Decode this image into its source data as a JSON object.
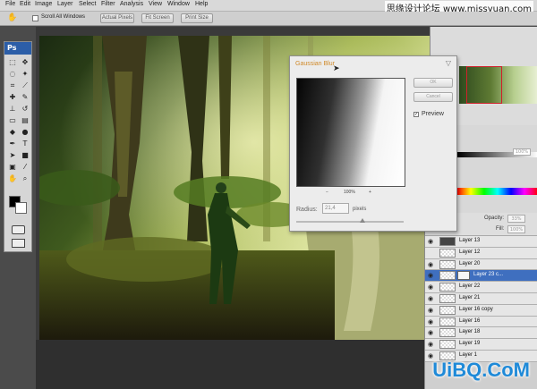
{
  "menu": [
    "File",
    "Edit",
    "Image",
    "Layer",
    "Select",
    "Filter",
    "Analysis",
    "View",
    "Window",
    "Help"
  ],
  "watermark_top": "思缘设计论坛 www.missyuan.com",
  "options_bar": {
    "scroll_all_label": "Scroll All Windows",
    "actual_pixels": "Actual Pixels",
    "fit_screen": "Fit Screen",
    "print_size": "Print Size"
  },
  "tools_header": "Ps",
  "dialog": {
    "title": "Gaussian Blur",
    "close_glyph": "▽",
    "ok_label": "OK",
    "cancel_label": "Cancel",
    "preview_label": "Preview",
    "zoom_minus": "−",
    "zoom_value": "100%",
    "zoom_plus": "+",
    "radius_label": "Radius:",
    "radius_value": "21,4",
    "radius_unit": "pixels",
    "slider_fraction": 0.62
  },
  "color_panel": {
    "percent": "100%"
  },
  "layers_panel": {
    "opacity_label": "Opacity:",
    "opacity_value": "33%",
    "fill_label": "Fill:",
    "fill_value": "100%",
    "layers": [
      {
        "name": "Layer 13",
        "visible": true,
        "selected": false,
        "thumb": "filled"
      },
      {
        "name": "Layer 12",
        "visible": false,
        "selected": false,
        "thumb": "transparent"
      },
      {
        "name": "Layer 20",
        "visible": true,
        "selected": false,
        "thumb": "transparent"
      },
      {
        "name": "Layer 23 c...",
        "visible": true,
        "selected": true,
        "thumb": "transparent"
      },
      {
        "name": "Layer 22",
        "visible": true,
        "selected": false,
        "thumb": "transparent"
      },
      {
        "name": "Layer 21",
        "visible": true,
        "selected": false,
        "thumb": "transparent"
      },
      {
        "name": "Layer 16 copy",
        "visible": true,
        "selected": false,
        "thumb": "transparent"
      },
      {
        "name": "Layer 16",
        "visible": true,
        "selected": false,
        "thumb": "transparent"
      },
      {
        "name": "Layer 18",
        "visible": true,
        "selected": false,
        "thumb": "transparent"
      },
      {
        "name": "Layer 19",
        "visible": true,
        "selected": false,
        "thumb": "transparent"
      },
      {
        "name": "Layer 1",
        "visible": true,
        "selected": false,
        "thumb": "transparent"
      }
    ]
  },
  "watermark_bottom": "UiBQ.CoM",
  "colors": {
    "ps_blue": "#2c5ea8",
    "selection_blue": "#3f6fbf",
    "navigator_red": "#d0202a",
    "dialog_title": "#d08a2a"
  }
}
